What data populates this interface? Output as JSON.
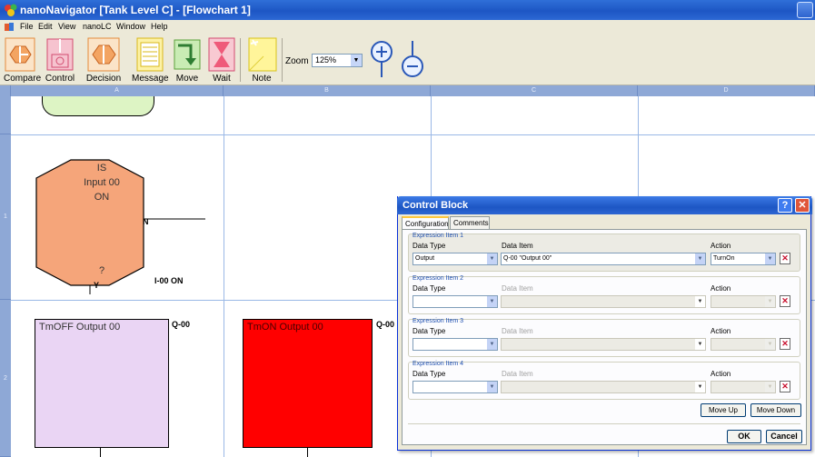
{
  "window": {
    "title": "nanoNavigator [Tank Level C] - [Flowchart 1]"
  },
  "menu": {
    "items": [
      "File",
      "Edit",
      "View",
      "nanoLC",
      "Window",
      "Help"
    ]
  },
  "toolbar": {
    "tools": [
      "Compare",
      "Control",
      "Decision",
      "Message",
      "Move",
      "Wait",
      "Note"
    ],
    "zoom_label": "Zoom",
    "zoom_value": "125%"
  },
  "grid": {
    "columns": [
      "A",
      "B",
      "C",
      "D"
    ],
    "rows": [
      "1",
      "2"
    ]
  },
  "flowchart": {
    "decision": {
      "line1": "IS",
      "line2": "Input 00",
      "line3": "ON",
      "question": "?",
      "no_label": "N",
      "yes_label": "Y",
      "tag": "I-00 ON"
    },
    "off_box": {
      "text": "TmOFF    Output 00",
      "tag": "Q-00",
      "color": "#ead5f4"
    },
    "on_box": {
      "text": "TmON    Output 00",
      "tag": "Q-00",
      "color": "#ff0000"
    },
    "start_block_color": "#ddf4c4",
    "decision_color": "#f5a57a"
  },
  "dialog": {
    "title": "Control Block",
    "tabs": [
      "Configuration",
      "Comments"
    ],
    "headers": {
      "data_type": "Data Type",
      "data_item": "Data Item",
      "action": "Action"
    },
    "items": [
      {
        "title": "Expression Item 1",
        "data_type": "Output",
        "data_item": "Q-00 \"Output 00\"",
        "action": "TurnOn"
      },
      {
        "title": "Expression Item 2",
        "data_type": "",
        "data_item": "",
        "action": ""
      },
      {
        "title": "Expression Item 3",
        "data_type": "",
        "data_item": "",
        "action": ""
      },
      {
        "title": "Expression Item 4",
        "data_type": "",
        "data_item": "",
        "action": ""
      }
    ],
    "move_up": "Move Up",
    "move_down": "Move Down",
    "ok": "OK",
    "cancel": "Cancel"
  }
}
